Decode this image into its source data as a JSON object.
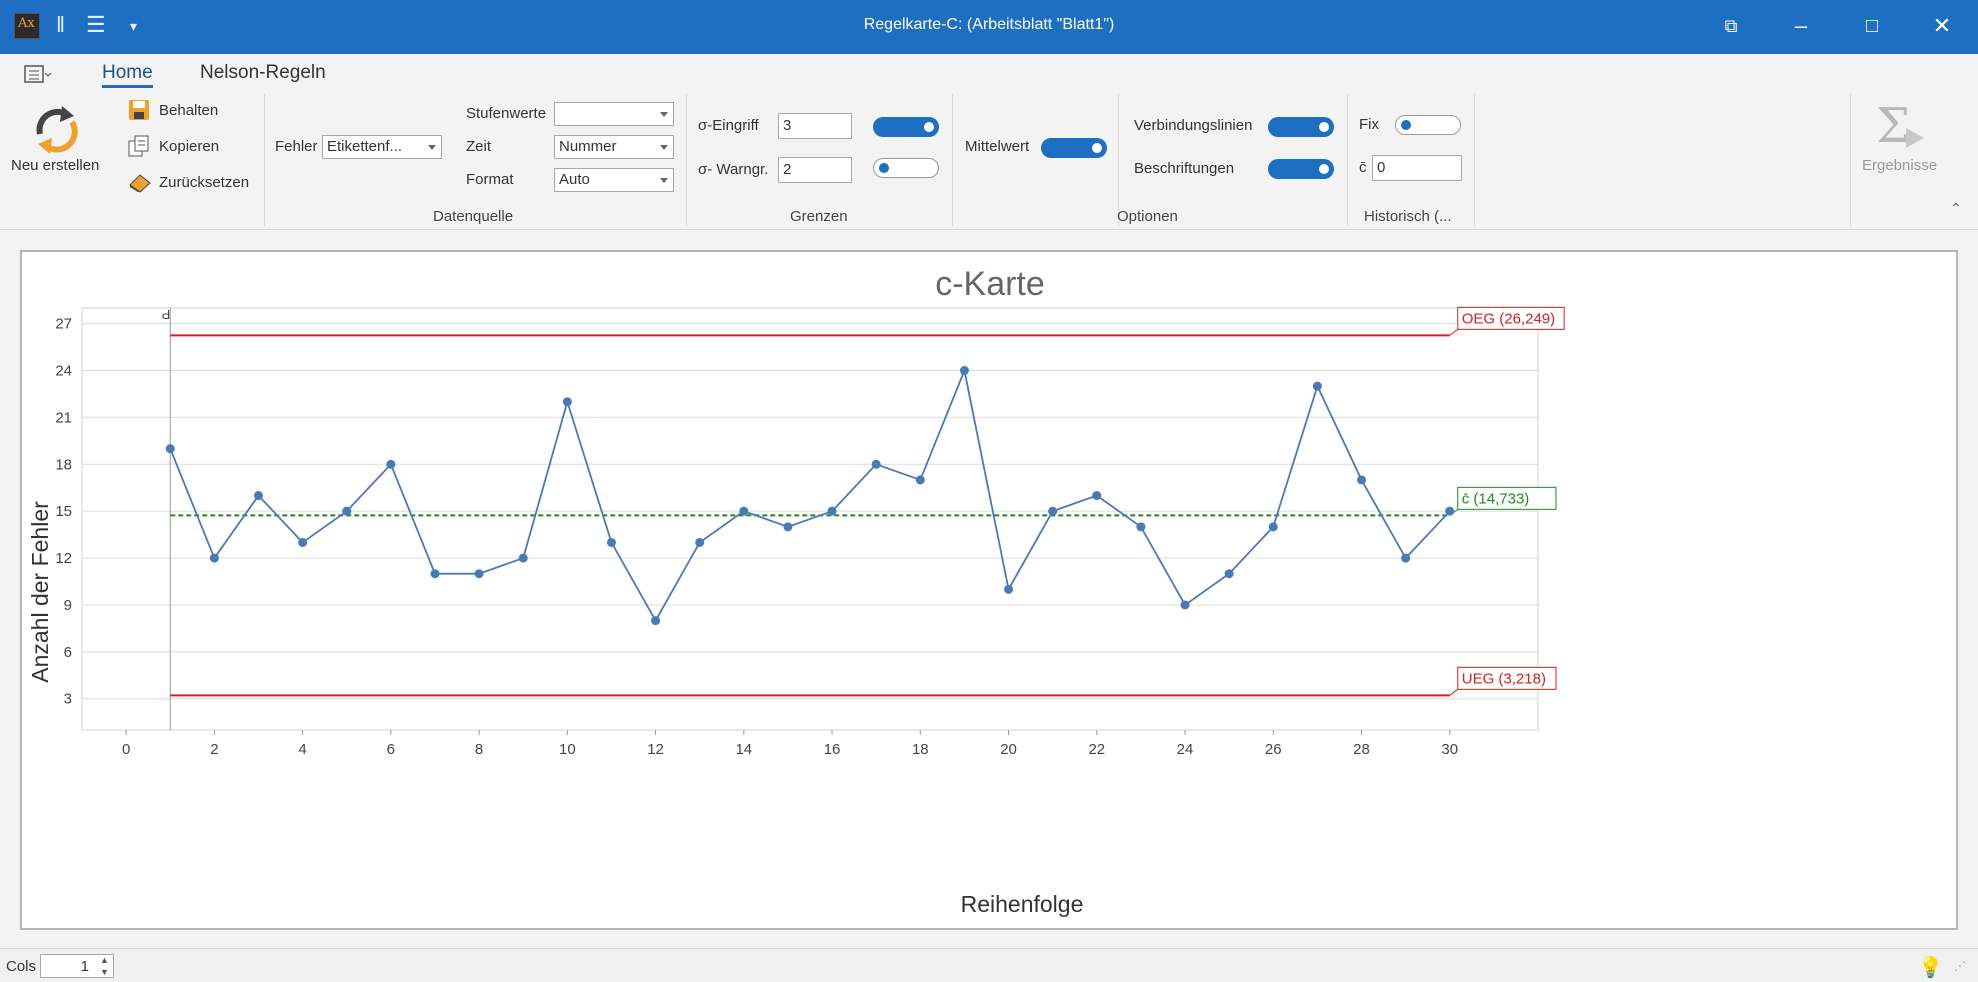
{
  "window": {
    "title": "Regelkarte-C:  (Arbeitsblatt \"Blatt1\")",
    "app_icon_text": "Ax",
    "accent": "#1e6fc1"
  },
  "ribbon": {
    "tabs": [
      "Home",
      "Nelson-Regeln"
    ],
    "new_label": "Neu erstellen",
    "keep_label": "Behalten",
    "copy_label": "Kopieren",
    "reset_label": "Zurücksetzen",
    "datasource": {
      "fehler_label": "Fehler",
      "fehler_value": "Etikettenf...",
      "stufen_label": "Stufenwerte",
      "stufen_value": "",
      "zeit_label": "Zeit",
      "zeit_value": "Nummer",
      "format_label": "Format",
      "format_value": "Auto",
      "group_title": "Datenquelle"
    },
    "limits": {
      "eingriff_label": "σ-Eingriff",
      "eingriff_value": "3",
      "eingriff_toggle": "on",
      "warn_label": "σ- Warngr.",
      "warn_value": "2",
      "warn_toggle": "off",
      "group_title": "Grenzen"
    },
    "options": {
      "mean_label": "Mittelwert",
      "mean_toggle": "on",
      "lines_label": "Verbindungslinien",
      "lines_toggle": "on",
      "labels_label": "Beschriftungen",
      "labels_toggle": "on",
      "group_title": "Optionen"
    },
    "historic": {
      "fix_label": "Fix",
      "fix_toggle": "off",
      "cbar_label": "c̄",
      "cbar_value": "0",
      "group_title": "Historisch (..."
    },
    "results_label": "Ergebnisse"
  },
  "chart_data": {
    "type": "line",
    "title": "c-Karte",
    "xlabel": "Reihenfolge",
    "ylabel": "Anzahl der Fehler",
    "x": [
      1,
      2,
      3,
      4,
      5,
      6,
      7,
      8,
      9,
      10,
      11,
      12,
      13,
      14,
      15,
      16,
      17,
      18,
      19,
      20,
      21,
      22,
      23,
      24,
      25,
      26,
      27,
      28,
      29,
      30
    ],
    "y": [
      19,
      12,
      16,
      13,
      15,
      18,
      11,
      11,
      12,
      22,
      13,
      8,
      13,
      15,
      14,
      15,
      18,
      17,
      24,
      10,
      15,
      16,
      14,
      9,
      11,
      14,
      23,
      17,
      12,
      15
    ],
    "xlim": [
      -1,
      32
    ],
    "ylim": [
      1,
      28
    ],
    "xticks": [
      0,
      2,
      4,
      6,
      8,
      10,
      12,
      14,
      16,
      18,
      20,
      22,
      24,
      26,
      28,
      30
    ],
    "yticks": [
      3,
      6,
      9,
      12,
      15,
      18,
      21,
      24,
      27
    ],
    "grid": true,
    "series_color": "#4a7ab5",
    "lines": [
      {
        "name": "OEG",
        "label": "OEG (26,249)",
        "value": 26.249,
        "color": "#d62020",
        "style": "solid"
      },
      {
        "name": "c̄",
        "label": "c̄ (14,733)",
        "value": 14.733,
        "color": "#1e8a1e",
        "style": "dashed"
      },
      {
        "name": "UEG",
        "label": "UEG (3,218)",
        "value": 3.218,
        "color": "#d62020",
        "style": "solid"
      }
    ],
    "phase_marker": "P"
  },
  "statusbar": {
    "cols_label": "Cols",
    "cols_value": "1"
  }
}
